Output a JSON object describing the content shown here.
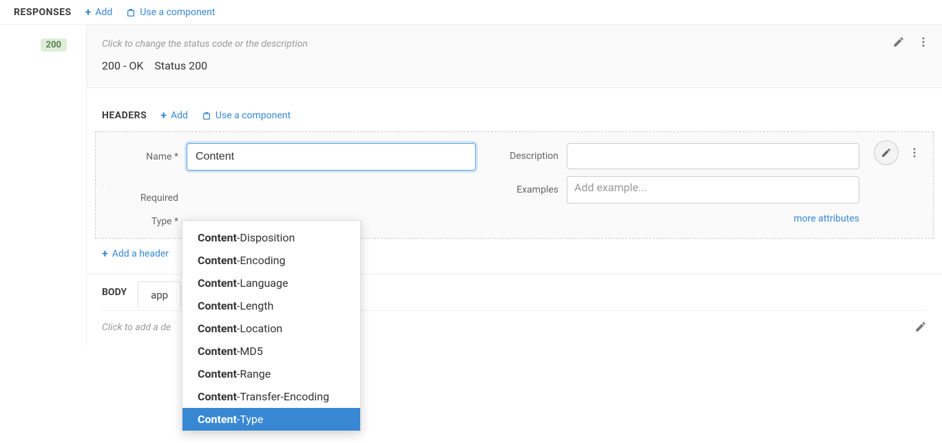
{
  "topbar": {
    "title": "RESPONSES",
    "add_label": "Add",
    "use_component_label": "Use a component"
  },
  "response": {
    "status_code": "200",
    "hint": "Click to change the status code or the description",
    "status_text": "200 - OK",
    "status_extra": "Status 200"
  },
  "headers_section": {
    "title": "HEADERS",
    "add_label": "Add",
    "use_component_label": "Use a component"
  },
  "form": {
    "name_label": "Name",
    "name_value": "Content",
    "required_label": "Required",
    "type_label": "Type",
    "description_label": "Description",
    "description_value": "",
    "examples_label": "Examples",
    "examples_placeholder": "Add example...",
    "more_attributes": "more attributes"
  },
  "add_header_label": "Add a header",
  "body": {
    "label": "BODY",
    "tab_label_visible": "app",
    "hint_visible": "Click to add a de",
    "tab_label_full": "application/json",
    "hint_full": "Click to add a description"
  },
  "autocomplete": {
    "match": "Content",
    "items": [
      {
        "prefix": "Content",
        "suffix": "-Disposition",
        "selected": false
      },
      {
        "prefix": "Content",
        "suffix": "-Encoding",
        "selected": false
      },
      {
        "prefix": "Content",
        "suffix": "-Language",
        "selected": false
      },
      {
        "prefix": "Content",
        "suffix": "-Length",
        "selected": false
      },
      {
        "prefix": "Content",
        "suffix": "-Location",
        "selected": false
      },
      {
        "prefix": "Content",
        "suffix": "-MD5",
        "selected": false
      },
      {
        "prefix": "Content",
        "suffix": "-Range",
        "selected": false
      },
      {
        "prefix": "Content",
        "suffix": "-Transfer-Encoding",
        "selected": false
      },
      {
        "prefix": "Content",
        "suffix": "-Type",
        "selected": true
      }
    ]
  }
}
